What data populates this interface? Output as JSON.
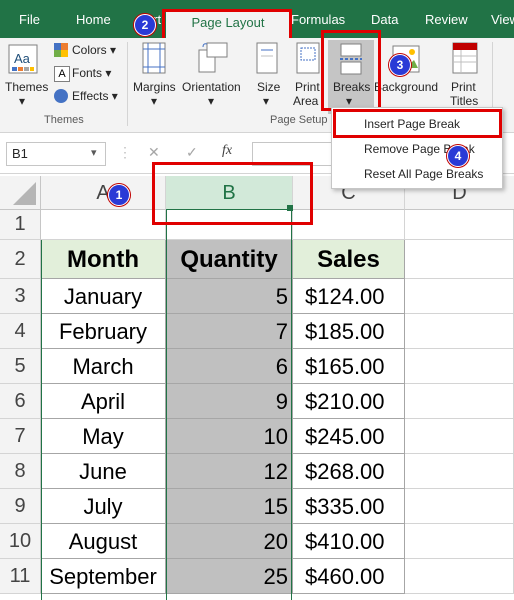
{
  "colors": {
    "accent": "#217346",
    "highlight": "#e00000",
    "badge": "#2a3ad6",
    "header_fill": "#e2efda",
    "selected_col": "#c0c0c0"
  },
  "tabs": [
    "File",
    "Home",
    "Insert",
    "Page Layout",
    "Formulas",
    "Data",
    "Review",
    "View"
  ],
  "tabs_visible": {
    "file": "File",
    "home": "Home",
    "insert": "ert",
    "page_layout": "Page Layout",
    "formulas": "Formulas",
    "data": "Data",
    "review": "Review",
    "view": "View"
  },
  "ribbon": {
    "themes_group": {
      "themes_label": "Themes",
      "colors_label": "Colors",
      "fonts_label": "Fonts",
      "effects_label": "Effects",
      "group_label": "Themes"
    },
    "page_setup_group": {
      "margins": "Margins",
      "orientation": "Orientation",
      "size": "Size",
      "print_area_line1": "Print",
      "print_area_line2": "Area",
      "breaks": "Breaks",
      "background": "Background",
      "print_titles_line1": "Print",
      "print_titles_line2": "Titles",
      "group_label": "Page Setup"
    }
  },
  "breaks_menu": {
    "items": [
      "Insert Page Break",
      "Remove Page Break",
      "Reset All Page Breaks"
    ]
  },
  "formula_bar": {
    "name_box": "B1",
    "fx": "fx",
    "cancel": "✕",
    "enter": "✓"
  },
  "columns": [
    "A",
    "B",
    "C",
    "D"
  ],
  "rows": [
    "1",
    "2",
    "3",
    "4",
    "5",
    "6",
    "7",
    "8",
    "9",
    "10",
    "11"
  ],
  "table": {
    "headers": [
      "Month",
      "Quantity",
      "Sales"
    ],
    "data": [
      [
        "January",
        "5",
        "$124.00"
      ],
      [
        "February",
        "7",
        "$185.00"
      ],
      [
        "March",
        "6",
        "$165.00"
      ],
      [
        "April",
        "9",
        "$210.00"
      ],
      [
        "May",
        "10",
        "$245.00"
      ],
      [
        "June",
        "12",
        "$268.00"
      ],
      [
        "July",
        "15",
        "$335.00"
      ],
      [
        "August",
        "20",
        "$410.00"
      ],
      [
        "September",
        "25",
        "$460.00"
      ]
    ]
  },
  "badges": [
    "1",
    "2",
    "3",
    "4"
  ]
}
